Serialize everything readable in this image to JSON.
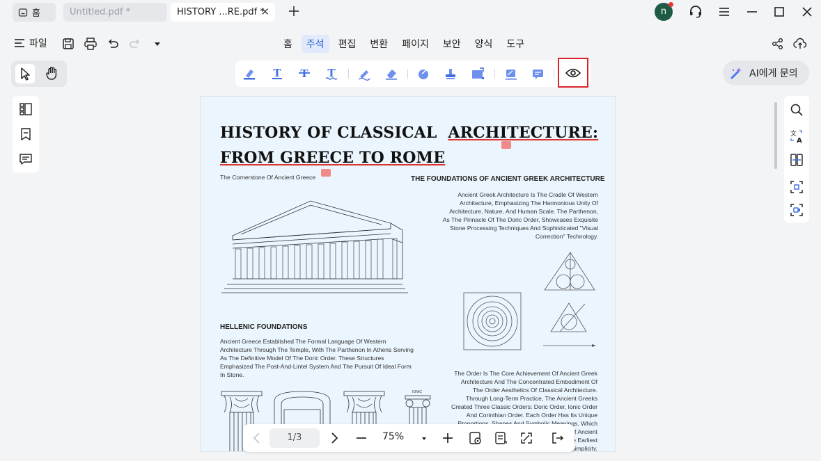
{
  "tabs": {
    "home_label": "홈",
    "tab1_label": "Untitled.pdf *",
    "tab2_label": "HISTORY ...RE.pdf *",
    "close_glyph": "✕"
  },
  "user": {
    "avatar_letter": "n"
  },
  "menu": {
    "file_label": "파일",
    "items": [
      "홈",
      "주석",
      "편집",
      "변환",
      "페이지",
      "보안",
      "양식",
      "도구"
    ],
    "active": "주석"
  },
  "ai": {
    "label": "AI에게 문의"
  },
  "colors": {
    "accent": "#2f64d8",
    "highlight_box": "#d9232d",
    "page_bg": "#eaf5fd"
  },
  "document": {
    "title_line1_a": "HISTORY OF CLASSICAL",
    "title_line1_b": "ARCHITECTURE:",
    "title_line2": "FROM GREECE TO ROME",
    "caption": "The Cornerstone Of Ancient Greece",
    "section1_heading": "THE FOUNDATIONS OF ANCIENT GREEK ARCHITECTURE",
    "section1_body": [
      "Ancient Greek Architecture Is The Cradle Of Western",
      "Architecture, Emphasizing The Harmonious Unity Of",
      "Architecture, Nature, And Human Scale. The Parthenon,",
      "As The Pinnacle Of The Doric Order, Showcases Exquisite",
      "Stone Processing Techniques And Sophisticated \"Visual",
      "Correction\" Technology."
    ],
    "section2_heading": "HELLENIC FOUNDATIONS",
    "section2_body": [
      "Ancient Greece Established The Formal Language Of Western",
      "Architecture Through The Temple, With The Parthenon In Athens Serving",
      "As The Definitive Model Of The Doric Order. These Structures",
      "Emphasized The Post-And-Lintel System And The Pursuit Of Ideal Form",
      "In Stone."
    ],
    "section3_body": [
      "The Order Is The Core Achievement Of Ancient Greek",
      "Architecture And The Concentrated Embodiment Of",
      "The Order Aesthetics Of Classical Architecture.",
      "Through Long-Term Practice, The Ancient Greeks",
      "Created Three Classic Orders: Doric Order, Ionic Order",
      "And Corinthian Order. Each Order Has Its Unique",
      "Proportions, Shapes And Symbolic Meanings, Which",
      "f Ancient",
      "e Earliest",
      "simplicity."
    ],
    "ionic_label": "IONIC"
  },
  "bottom": {
    "page_indicator": "1/3",
    "zoom": "75%"
  }
}
